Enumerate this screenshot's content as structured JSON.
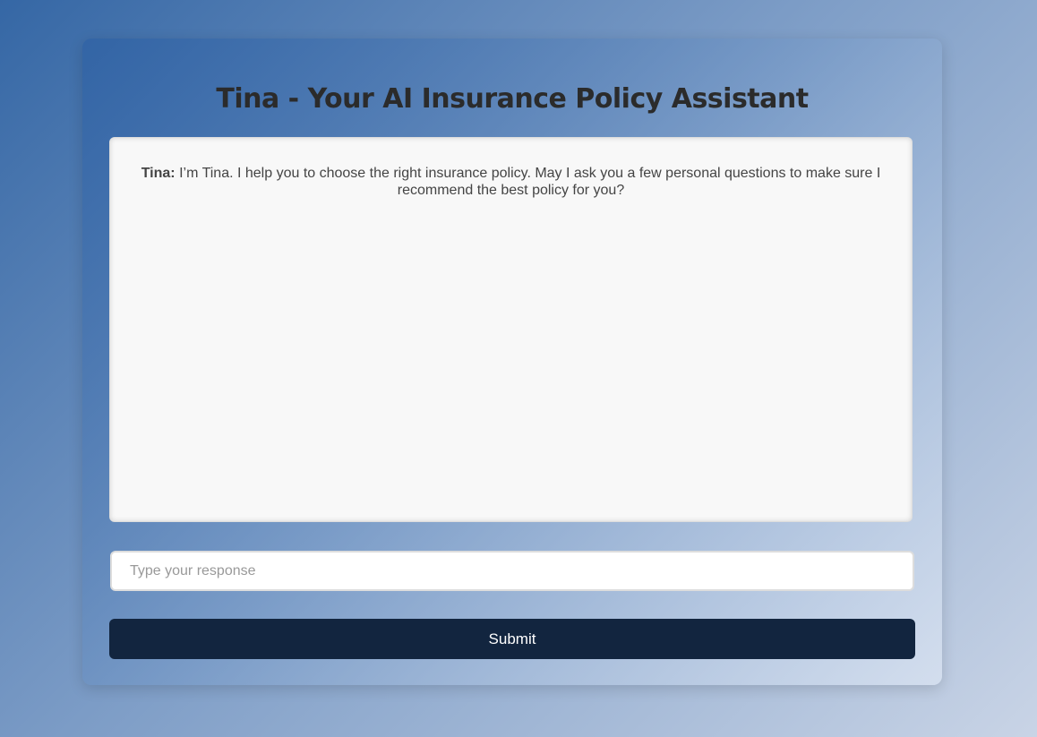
{
  "header": {
    "title": "Tina - Your AI Insurance Policy Assistant"
  },
  "chat": {
    "messages": [
      {
        "sender": "Tina:",
        "text": "I’m Tina. I help you to choose the right insurance policy. May I ask you a few personal questions to make sure I recommend the best policy for you?"
      }
    ]
  },
  "input": {
    "placeholder": "Type your response",
    "value": ""
  },
  "submit": {
    "label": "Submit"
  },
  "colors": {
    "button": "#12253f",
    "background_start": "#3567a5",
    "background_end": "#c9d4e6"
  }
}
